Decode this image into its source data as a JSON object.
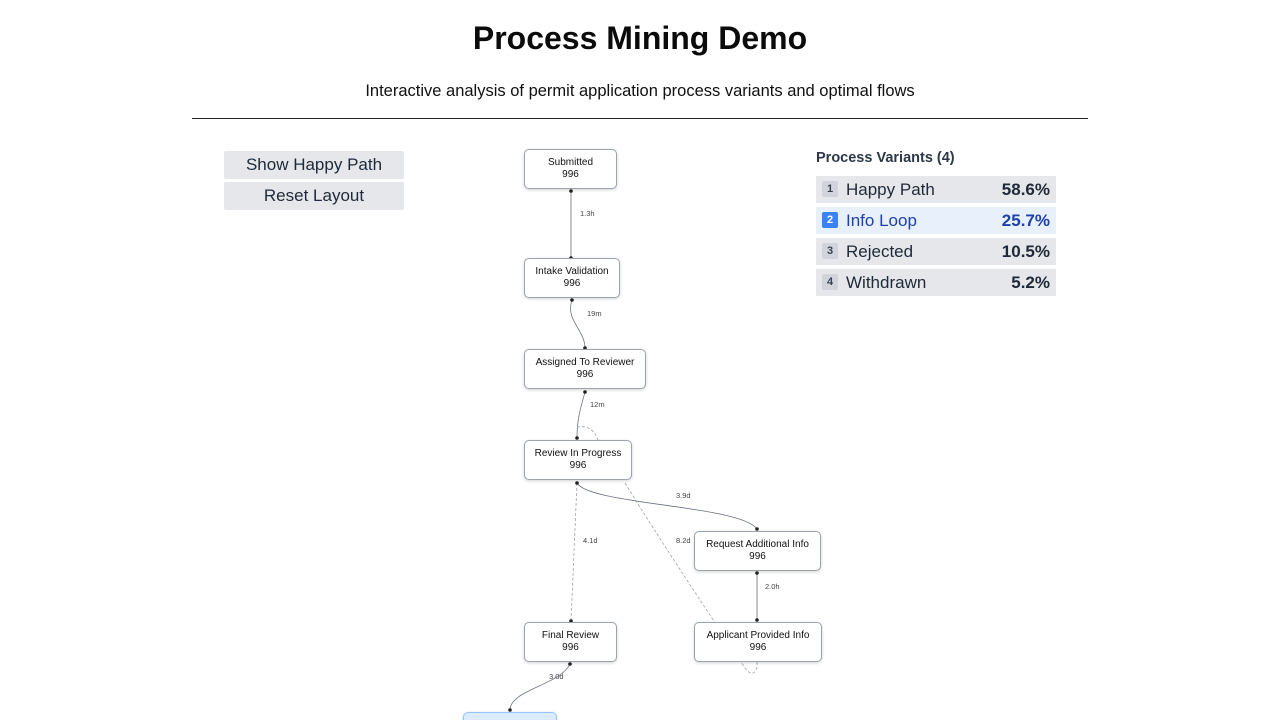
{
  "header": {
    "title": "Process Mining Demo",
    "subtitle": "Interactive analysis of permit application process variants and optimal flows"
  },
  "controls": {
    "happy_path_label": "Show Happy Path",
    "reset_layout_label": "Reset Layout"
  },
  "graph": {
    "nodes": [
      {
        "name": "Submitted",
        "count": "996"
      },
      {
        "name": "Intake Validation",
        "count": "996"
      },
      {
        "name": "Assigned To Reviewer",
        "count": "996"
      },
      {
        "name": "Review In Progress",
        "count": "996"
      },
      {
        "name": "Request Additional Info",
        "count": "996"
      },
      {
        "name": "Final Review",
        "count": "996"
      },
      {
        "name": "Applicant Provided Info",
        "count": "996"
      }
    ],
    "edge_labels": [
      "1.3h",
      "19m",
      "12m",
      "3.9d",
      "4.1d",
      "8.2d",
      "2.0h",
      "3.0d"
    ]
  },
  "variants": {
    "title": "Process Variants (4)",
    "items": [
      {
        "num": "1",
        "name": "Happy Path",
        "pct": "58.6%"
      },
      {
        "num": "2",
        "name": "Info Loop",
        "pct": "25.7%"
      },
      {
        "num": "3",
        "name": "Rejected",
        "pct": "10.5%"
      },
      {
        "num": "4",
        "name": "Withdrawn",
        "pct": "5.2%"
      }
    ],
    "selected_index": 1
  },
  "colors": {
    "selected_accent": "#3b82f6",
    "selected_text": "#1e40af",
    "edge": "#9ca3af"
  }
}
